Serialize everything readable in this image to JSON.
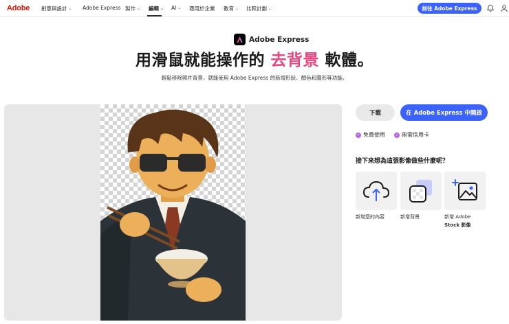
{
  "nav": {
    "logo": "Adobe",
    "items": [
      {
        "label": "創意與設計",
        "has_menu": true
      },
      {
        "label": "Adobe Express",
        "has_menu": false
      },
      {
        "label": "製作",
        "has_menu": true
      },
      {
        "label": "編輯",
        "has_menu": true,
        "active": true
      },
      {
        "label": "AI",
        "has_menu": true
      },
      {
        "label": "適用於企業",
        "has_menu": false
      },
      {
        "label": "教育",
        "has_menu": true
      },
      {
        "label": "比較計劃",
        "has_menu": true
      }
    ],
    "cta": "前往 Adobe Express",
    "icons": [
      "bell-icon",
      "user-icon"
    ]
  },
  "hero": {
    "brand": "Adobe Express",
    "headline_pre": "用滑鼠就能操作的",
    "headline_highlight": "去背景",
    "headline_post": "軟體。",
    "subtitle": "輕鬆移除照片背景，就能使用 Adobe Express 的新增形狀、顏色和圖形等功能。"
  },
  "actions": {
    "download": "下載",
    "open": "在 Adobe Express 中開啟",
    "perks": [
      "免費使用",
      "無需信用卡"
    ]
  },
  "next": {
    "question": "接下來想為這張影像做些什麼呢？",
    "cards": [
      {
        "icon": "cloud-upload-icon",
        "label": "新增您的內容"
      },
      {
        "icon": "stacked-squares-icon",
        "label": "新增背景"
      },
      {
        "icon": "add-image-icon",
        "label_line1": "新增 Adobe",
        "label_line2": "Stock 影像"
      }
    ]
  },
  "colors": {
    "adobe_red": "#eb1000",
    "primary_blue": "#3b63fb",
    "highlight_pink": "#e94580",
    "perk_purple": "#b664e8"
  }
}
